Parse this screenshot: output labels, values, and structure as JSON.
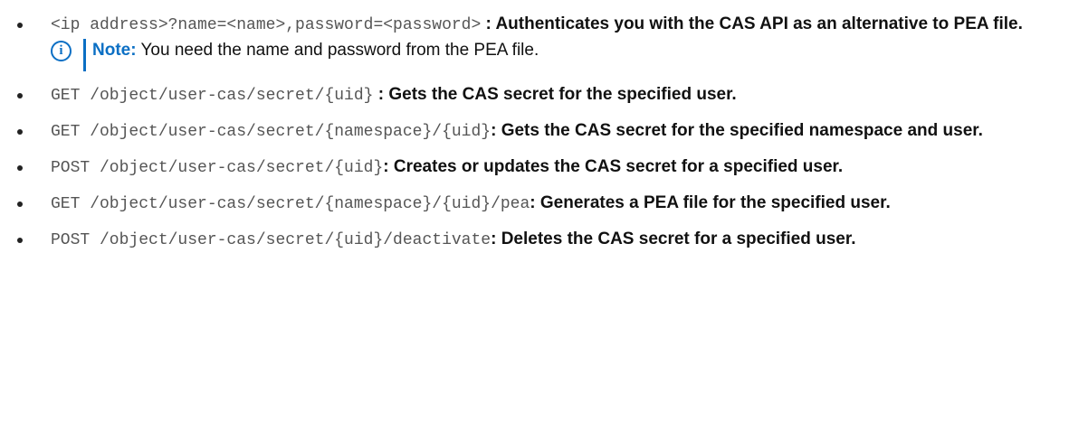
{
  "items": [
    {
      "code": "<ip address>?name=<name>,password=<password>",
      "description": " : Authenticates you with the CAS API as an alternative to PEA file."
    },
    {
      "code": "GET /object/user-cas/secret/{uid}",
      "description": " : Gets the CAS secret for the specified user."
    },
    {
      "code": "GET /object/user-cas/secret/{namespace}/{uid}",
      "description": ": Gets the CAS secret for the specified namespace and user."
    },
    {
      "code": "POST /object/user-cas/secret/{uid}",
      "description": ": Creates or updates the CAS secret for a specified user."
    },
    {
      "code": "GET /object/user-cas/secret/{namespace}/{uid}/pea",
      "description": ": Generates a PEA file for the specified user."
    },
    {
      "code": "POST /object/user-cas/secret/{uid}/deactivate",
      "description": ": Deletes the CAS secret for a specified user."
    }
  ],
  "note": {
    "icon": "info-icon",
    "label": "Note:",
    "text": " You need the name and password from the PEA file."
  },
  "colors": {
    "accent": "#0b6fc4",
    "code_text": "#555555",
    "body_text": "#111111"
  }
}
